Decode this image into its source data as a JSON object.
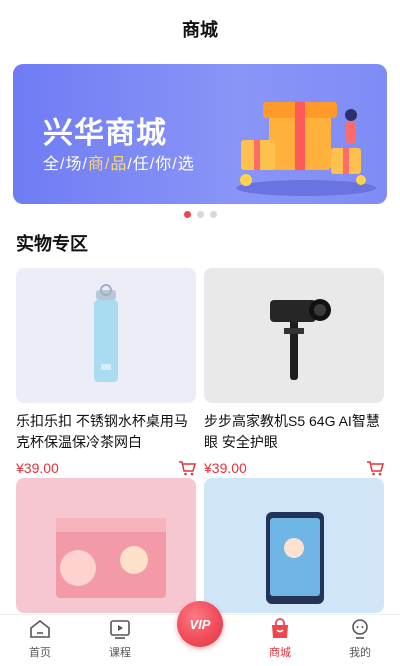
{
  "header": {
    "title": "商城"
  },
  "banner": {
    "title": "兴华商城",
    "subtitle_parts": [
      "全/场/",
      "商/品",
      "/任/你/选"
    ]
  },
  "carousel": {
    "count": 3,
    "active_index": 0
  },
  "section": {
    "title": "实物专区"
  },
  "products": [
    {
      "name": "乐扣乐扣 不锈钢水杯桌用马克杯保温保冷茶网白",
      "price": "¥39.00"
    },
    {
      "name": "步步高家教机S5 64G AI智慧眼 安全护眼",
      "price": "¥39.00"
    },
    {
      "name": "",
      "price": ""
    },
    {
      "name": "",
      "price": ""
    }
  ],
  "tabbar": {
    "items": [
      {
        "label": "首页",
        "icon": "home-icon"
      },
      {
        "label": "课程",
        "icon": "play-icon"
      },
      {
        "label": "VIP",
        "icon": "vip-icon"
      },
      {
        "label": "商城",
        "icon": "shopping-bag-icon"
      },
      {
        "label": "我的",
        "icon": "profile-icon"
      }
    ],
    "active": "商城"
  },
  "colors": {
    "accent": "#e5313b",
    "banner": "#7d89f5"
  }
}
